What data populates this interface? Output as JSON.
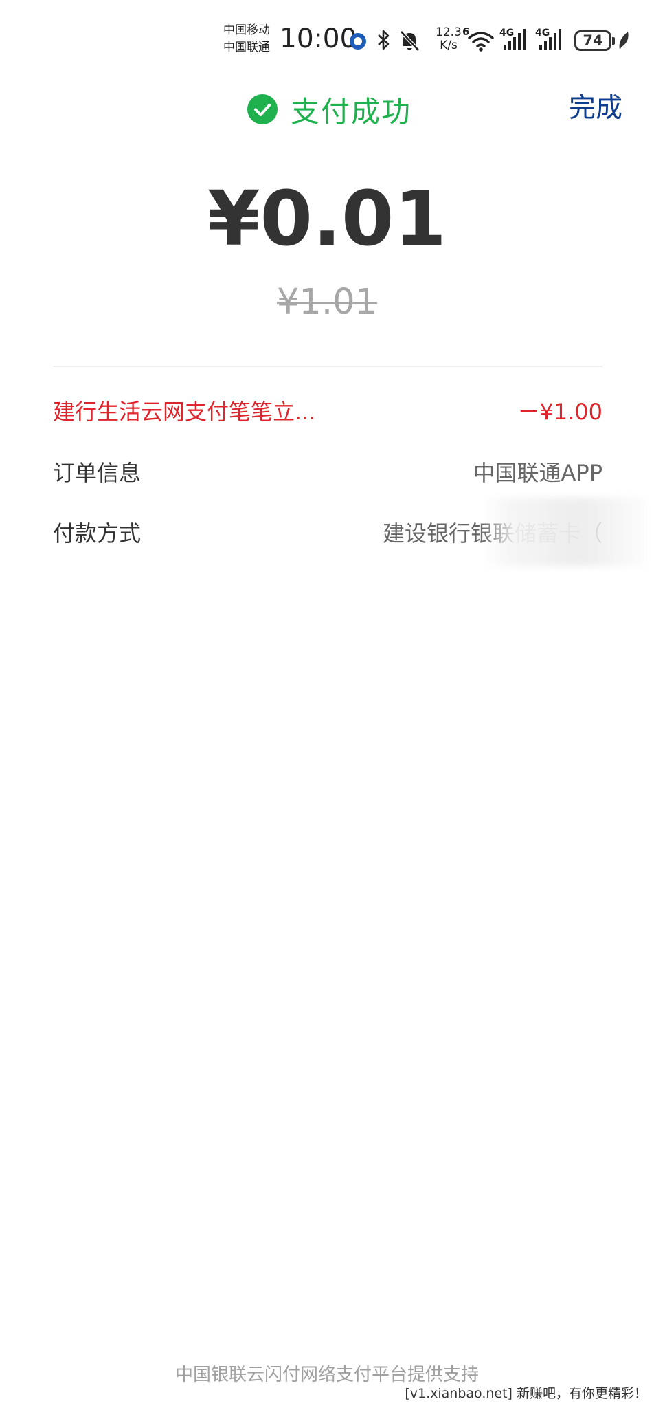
{
  "status_bar": {
    "carrier_1": "中国移动",
    "carrier_2": "中国联通",
    "time": "10:00",
    "net_speed_value": "12.3",
    "net_speed_unit": "K/s",
    "wifi_badge": "6",
    "signal_1_label": "4G",
    "signal_2_label": "4G",
    "battery": "74",
    "icons": [
      "app-notification-icon",
      "bluetooth-icon",
      "mute-bell-icon",
      "wifi-icon",
      "signal-icon",
      "signal-icon",
      "battery-icon",
      "leaf-icon"
    ]
  },
  "header": {
    "title": "支付成功",
    "done_label": "完成",
    "title_color": "#20b14f",
    "done_color": "#0e3d8e"
  },
  "payment": {
    "amount": "¥0.01",
    "original_amount": "¥1.01"
  },
  "details": {
    "discount_label": "建行生活云网支付笔笔立...",
    "discount_value": "－¥1.00",
    "discount_color": "#e0242c",
    "order_label": "订单信息",
    "order_value": "中国联通APP",
    "method_label": "付款方式",
    "method_value": "建设银行银联储蓄卡（"
  },
  "footer": {
    "support_text": "中国银联云闪付网络支付平台提供支持",
    "watermark": "[v1.xianbao.net] 新赚吧，有你更精彩！"
  }
}
